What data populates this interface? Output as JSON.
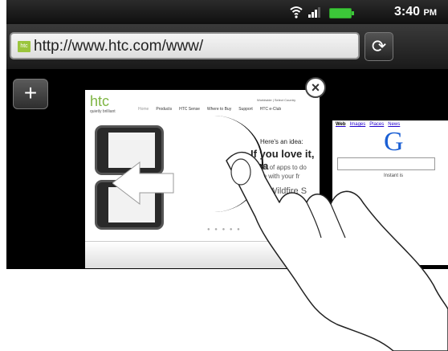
{
  "status_bar": {
    "time": "3:40",
    "ampm": "PM",
    "icons": [
      "wifi-icon",
      "signal-icon",
      "battery-icon"
    ]
  },
  "url_bar": {
    "url": "http://www.htc.com/www/",
    "favicon_text": "htc",
    "refresh_icon": "refresh-icon"
  },
  "tabs": {
    "add_icon": "plus-icon",
    "close_icon": "close-icon",
    "htc_page": {
      "logo": "htc",
      "tagline": "quietly brilliant",
      "top_links": "Worldwide | Select Country",
      "nav": [
        "Home",
        "Products",
        "HTC Sense",
        "Where to Buy",
        "Support",
        "HTC e-Club"
      ],
      "headline_small": "Here's an idea:",
      "headline_big": "If you love it, sha",
      "body_line1": "sands of apps to do",
      "body_line2": "share with your fr",
      "product_text": "C Wildfire S",
      "pager": "● ● ● ● ●"
    },
    "google_page": {
      "nav": [
        "Web",
        "Images",
        "Places",
        "News"
      ],
      "logo": "G",
      "instant": "Instant is"
    }
  },
  "colors": {
    "status_bar_bg": "#1a1a1a",
    "htc_green": "#7eb542",
    "battery_green": "#3cc739",
    "google_blue": "#1a5fd4"
  }
}
